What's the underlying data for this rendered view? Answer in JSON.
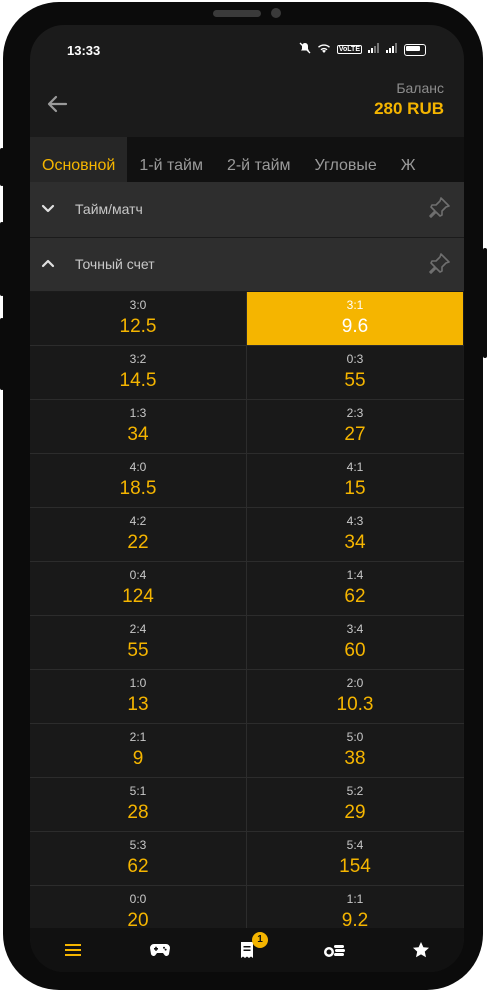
{
  "status": {
    "time": "13:33",
    "volte": "VoLTE"
  },
  "header": {
    "balance_label": "Баланс",
    "balance_value": "280 RUB"
  },
  "tabs": [
    {
      "label": "Основной",
      "active": true
    },
    {
      "label": "1-й тайм",
      "active": false
    },
    {
      "label": "2-й тайм",
      "active": false
    },
    {
      "label": "Угловые",
      "active": false
    },
    {
      "label": "Ж",
      "active": false
    }
  ],
  "sections": {
    "half_match": {
      "title": "Тайм/матч",
      "state": "collapsed"
    },
    "exact_score": {
      "title": "Точный счет",
      "state": "expanded"
    }
  },
  "scores": [
    [
      {
        "score": "3:0",
        "odd": "12.5"
      },
      {
        "score": "3:1",
        "odd": "9.6",
        "selected": true
      }
    ],
    [
      {
        "score": "3:2",
        "odd": "14.5"
      },
      {
        "score": "0:3",
        "odd": "55"
      }
    ],
    [
      {
        "score": "1:3",
        "odd": "34"
      },
      {
        "score": "2:3",
        "odd": "27"
      }
    ],
    [
      {
        "score": "4:0",
        "odd": "18.5"
      },
      {
        "score": "4:1",
        "odd": "15"
      }
    ],
    [
      {
        "score": "4:2",
        "odd": "22"
      },
      {
        "score": "4:3",
        "odd": "34"
      }
    ],
    [
      {
        "score": "0:4",
        "odd": "124"
      },
      {
        "score": "1:4",
        "odd": "62"
      }
    ],
    [
      {
        "score": "2:4",
        "odd": "55"
      },
      {
        "score": "3:4",
        "odd": "60"
      }
    ],
    [
      {
        "score": "1:0",
        "odd": "13"
      },
      {
        "score": "2:0",
        "odd": "10.3"
      }
    ],
    [
      {
        "score": "2:1",
        "odd": "9"
      },
      {
        "score": "5:0",
        "odd": "38"
      }
    ],
    [
      {
        "score": "5:1",
        "odd": "28"
      },
      {
        "score": "5:2",
        "odd": "29"
      }
    ],
    [
      {
        "score": "5:3",
        "odd": "62"
      },
      {
        "score": "5:4",
        "odd": "154"
      }
    ],
    [
      {
        "score": "0:0",
        "odd": "20"
      },
      {
        "score": "1:1",
        "odd": "9.2"
      }
    ]
  ],
  "bottom_nav": [
    {
      "icon": "menu-icon",
      "active": true
    },
    {
      "icon": "gamepad-icon"
    },
    {
      "icon": "betslip-icon",
      "badge": "1"
    },
    {
      "icon": "coins-icon"
    },
    {
      "icon": "star-icon"
    }
  ],
  "colors": {
    "accent": "#f5b500",
    "background": "#1b1b1b"
  }
}
